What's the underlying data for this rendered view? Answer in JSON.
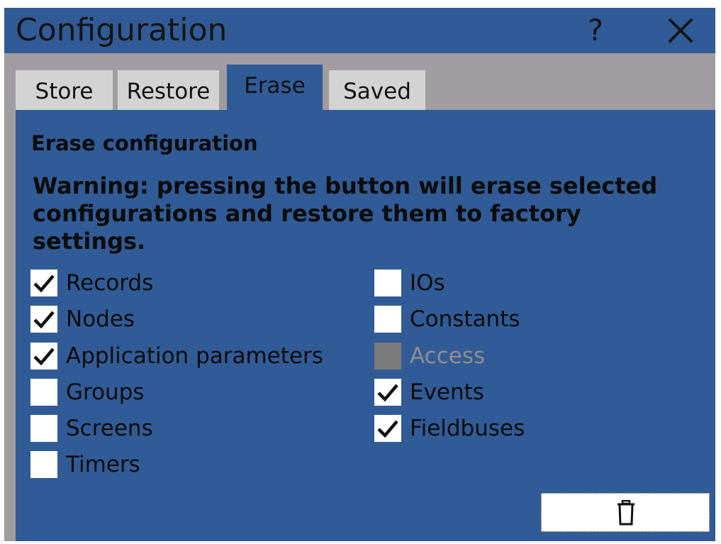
{
  "window": {
    "title": "Configuration",
    "help_label": "?",
    "close_icon": "close-icon"
  },
  "tabs": [
    {
      "label": "Store",
      "active": false
    },
    {
      "label": "Restore",
      "active": false
    },
    {
      "label": "Erase",
      "active": true
    },
    {
      "label": "Saved",
      "active": false
    }
  ],
  "erase": {
    "heading": "Erase configuration",
    "warning": "Warning: pressing the button will erase selected configurations and restore them to factory settings.",
    "left_options": [
      {
        "label": "Records",
        "checked": true,
        "enabled": true
      },
      {
        "label": "Nodes",
        "checked": true,
        "enabled": true
      },
      {
        "label": "Application parameters",
        "checked": true,
        "enabled": true
      },
      {
        "label": "Groups",
        "checked": false,
        "enabled": true
      },
      {
        "label": "Screens",
        "checked": false,
        "enabled": true
      },
      {
        "label": "Timers",
        "checked": false,
        "enabled": true
      }
    ],
    "right_options": [
      {
        "label": "IOs",
        "checked": false,
        "enabled": true
      },
      {
        "label": "Constants",
        "checked": false,
        "enabled": true
      },
      {
        "label": "Access",
        "checked": false,
        "enabled": false
      },
      {
        "label": "Events",
        "checked": true,
        "enabled": true
      },
      {
        "label": "Fieldbuses",
        "checked": true,
        "enabled": true
      }
    ],
    "button_icon": "trash-icon"
  },
  "colors": {
    "panel_blue": "#315b96",
    "frame_gray": "#a09da0",
    "tab_gray": "#d3d3d3",
    "disabled_box": "#7b7b7b",
    "disabled_text": "#8f8f8f"
  }
}
